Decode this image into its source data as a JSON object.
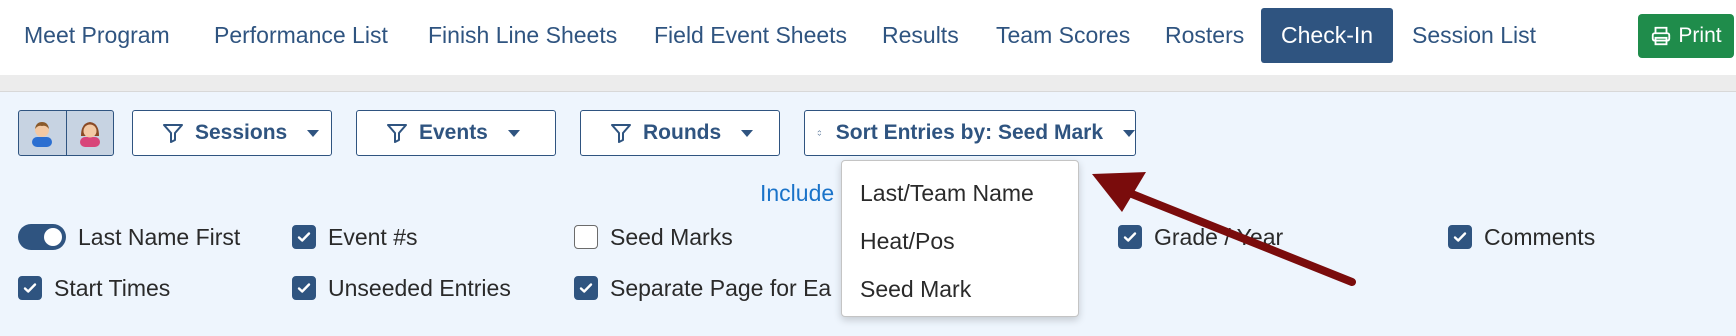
{
  "nav": {
    "items": [
      "Meet Program",
      "Performance List",
      "Finish Line Sheets",
      "Field Event Sheets",
      "Results",
      "Team Scores",
      "Rosters",
      "Check-In",
      "Session List"
    ],
    "active": "Check-In",
    "print_label": "Print"
  },
  "filters": {
    "gender_buttons": [
      {
        "icon": "male-user-icon",
        "pressed": true
      },
      {
        "icon": "female-user-icon",
        "pressed": true
      }
    ],
    "sessions_label": "Sessions",
    "events_label": "Events",
    "rounds_label": "Rounds",
    "sort_label": "Sort Entries by: Seed Mark"
  },
  "include_link": "Include",
  "options": {
    "last_name_first": {
      "label": "Last Name First",
      "type": "toggle",
      "on": true
    },
    "event_numbers": {
      "label": "Event #s",
      "checked": true
    },
    "seed_marks": {
      "label": "Seed Marks",
      "checked": false
    },
    "grade_year": {
      "label": "Grade / Year",
      "checked": true
    },
    "comments": {
      "label": "Comments",
      "checked": true
    },
    "start_times": {
      "label": "Start Times",
      "checked": true
    },
    "unseeded_entries": {
      "label": "Unseeded Entries",
      "checked": true
    },
    "separate_page": {
      "label": "Separate Page for Ea",
      "checked": true
    }
  },
  "sort_dropdown": {
    "options": [
      "Last/Team Name",
      "Heat/Pos",
      "Seed Mark"
    ]
  },
  "colors": {
    "primary": "#2f5480",
    "print_green": "#1f8c4b",
    "content_bg": "#eef5fd",
    "link_blue": "#1a73c9",
    "annotation_arrow": "#7a0c0c"
  }
}
